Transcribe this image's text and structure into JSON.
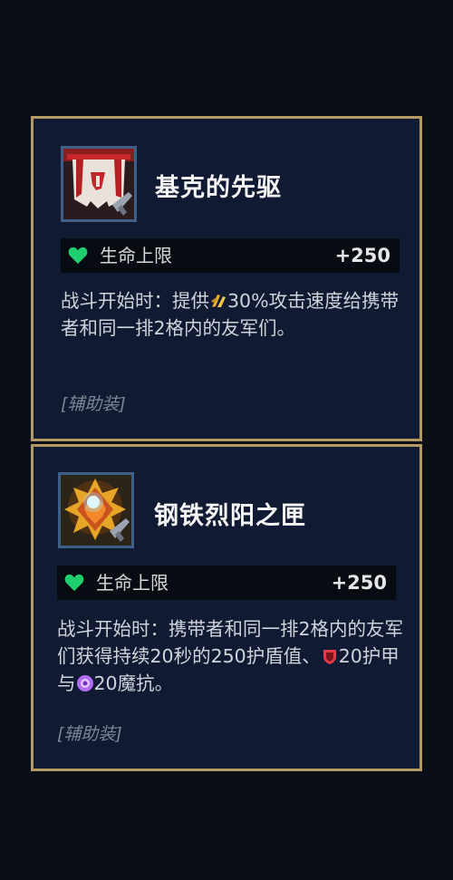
{
  "items": [
    {
      "title": "基克的先驱",
      "icon": "red-white-banner-icon",
      "stat": {
        "icon": "heart-icon",
        "name": "生命上限",
        "value": "+250"
      },
      "description": {
        "before": "战斗开始时：提供",
        "after": "30%攻击速度给携带者和同一排2格内的友军们。"
      },
      "tag": "[辅助装]"
    },
    {
      "title": "钢铁烈阳之匣",
      "icon": "golden-sun-locket-icon",
      "stat": {
        "icon": "heart-icon",
        "name": "生命上限",
        "value": "+250"
      },
      "description": {
        "part1": "战斗开始时：携带者和同一排2格内的友军们获得持续20秒的250护盾值、",
        "part2": "20护甲与",
        "part3": "20魔抗。"
      },
      "tag": "[辅助装]"
    }
  ],
  "colors": {
    "background": "#0a0e16",
    "card_background": "#101a33",
    "card_border": "#b39a64",
    "heart": "#1fcf6d",
    "armor": "#e43a4a",
    "magic_resist": "#b26cf0",
    "attack_speed": "#e9b12c"
  }
}
